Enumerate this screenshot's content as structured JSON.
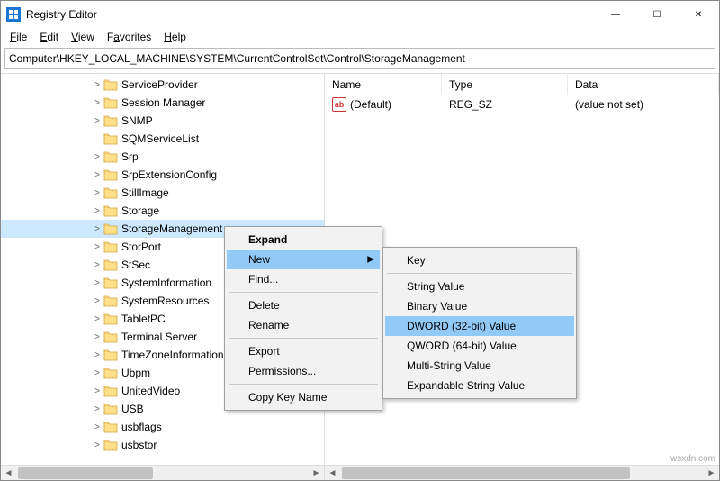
{
  "window": {
    "title": "Registry Editor",
    "buttons": {
      "min": "—",
      "max": "☐",
      "close": "✕"
    }
  },
  "menubar": {
    "file": "File",
    "edit": "Edit",
    "view": "View",
    "favorites": "Favorites",
    "help": "Help"
  },
  "address": "Computer\\HKEY_LOCAL_MACHINE\\SYSTEM\\CurrentControlSet\\Control\\StorageManagement",
  "tree": {
    "items": [
      {
        "label": "ServiceProvider",
        "expandable": true
      },
      {
        "label": "Session Manager",
        "expandable": true
      },
      {
        "label": "SNMP",
        "expandable": true
      },
      {
        "label": "SQMServiceList",
        "expandable": false
      },
      {
        "label": "Srp",
        "expandable": true
      },
      {
        "label": "SrpExtensionConfig",
        "expandable": true
      },
      {
        "label": "StillImage",
        "expandable": true
      },
      {
        "label": "Storage",
        "expandable": true
      },
      {
        "label": "StorageManagement",
        "expandable": true,
        "selected": true
      },
      {
        "label": "StorPort",
        "expandable": true
      },
      {
        "label": "StSec",
        "expandable": true
      },
      {
        "label": "SystemInformation",
        "expandable": true
      },
      {
        "label": "SystemResources",
        "expandable": true
      },
      {
        "label": "TabletPC",
        "expandable": true
      },
      {
        "label": "Terminal Server",
        "expandable": true
      },
      {
        "label": "TimeZoneInformation",
        "expandable": true
      },
      {
        "label": "Ubpm",
        "expandable": true
      },
      {
        "label": "UnitedVideo",
        "expandable": true
      },
      {
        "label": "USB",
        "expandable": true
      },
      {
        "label": "usbflags",
        "expandable": true
      },
      {
        "label": "usbstor",
        "expandable": true
      }
    ]
  },
  "list": {
    "headers": {
      "name": "Name",
      "type": "Type",
      "data": "Data"
    },
    "rows": [
      {
        "name": "(Default)",
        "type": "REG_SZ",
        "data": "(value not set)"
      }
    ]
  },
  "ctx1": {
    "expand": "Expand",
    "new": "New",
    "find": "Find...",
    "delete": "Delete",
    "rename": "Rename",
    "export": "Export",
    "permissions": "Permissions...",
    "copykey": "Copy Key Name"
  },
  "ctx2": {
    "key": "Key",
    "string": "String Value",
    "binary": "Binary Value",
    "dword": "DWORD (32-bit) Value",
    "qword": "QWORD (64-bit) Value",
    "multi": "Multi-String Value",
    "expand": "Expandable String Value"
  },
  "watermark": "wsxdn.com"
}
